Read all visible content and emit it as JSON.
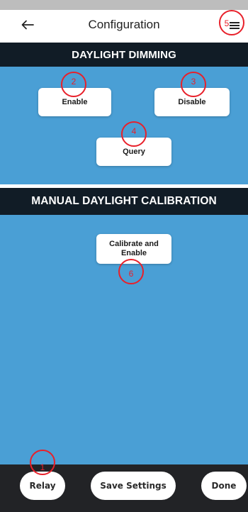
{
  "app_bar": {
    "title": "Configuration",
    "back_icon": "arrow-left-icon",
    "menu_icon": "hamburger-menu-icon"
  },
  "sections": {
    "daylight_dimming": {
      "header": "DAYLIGHT DIMMING",
      "enable_label": "Enable",
      "disable_label": "Disable",
      "query_label": "Query"
    },
    "manual_calibration": {
      "header": "MANUAL DAYLIGHT CALIBRATION",
      "calibrate_line1": "Calibrate and",
      "calibrate_line2": "Enable"
    }
  },
  "bottom_bar": {
    "relay_label": "Relay",
    "save_label": "Save Settings",
    "done_label": "Done"
  },
  "annotations": {
    "marker_1": "1",
    "marker_2": "2",
    "marker_3": "3",
    "marker_4": "4",
    "marker_5": "5",
    "marker_6": "6"
  },
  "colors": {
    "panel_blue": "#4a9fd5",
    "header_navy": "#111c26",
    "bottom_bar": "#222326",
    "annotation_red": "#e8202a"
  }
}
